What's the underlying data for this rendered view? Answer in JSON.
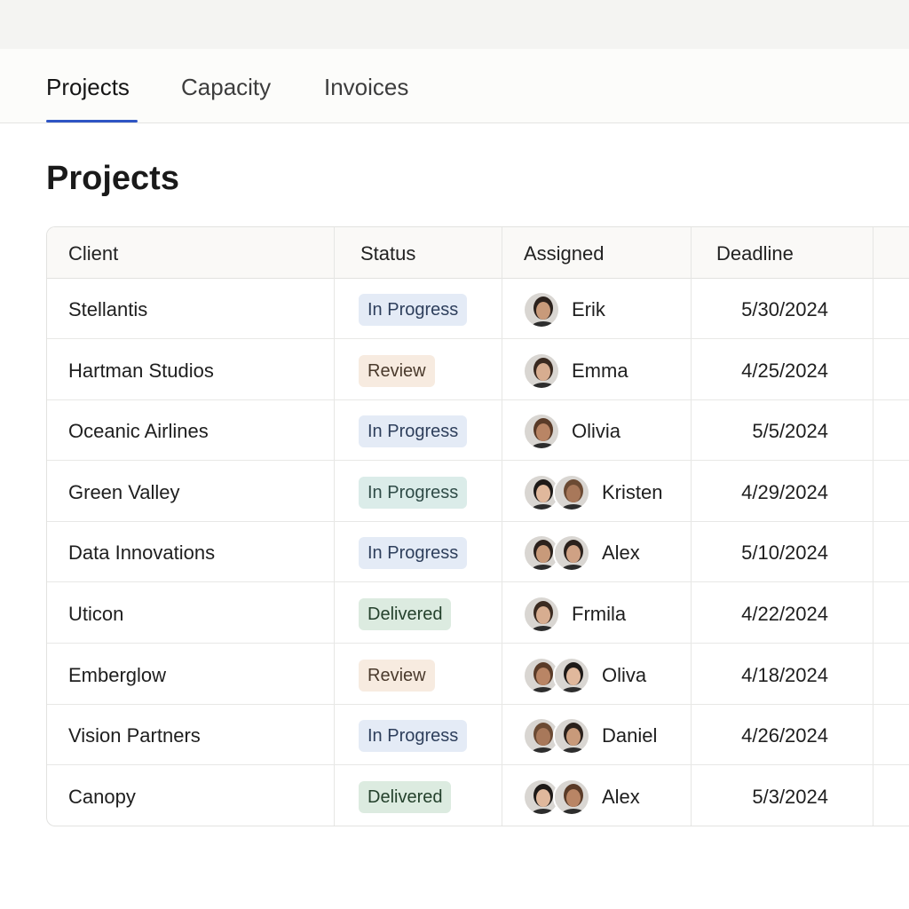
{
  "tabs": [
    {
      "label": "Projects",
      "active": true
    },
    {
      "label": "Capacity",
      "active": false
    },
    {
      "label": "Invoices",
      "active": false
    }
  ],
  "page_title": "Projects",
  "columns": {
    "client": "Client",
    "status": "Status",
    "assigned": "Assigned",
    "deadline": "Deadline"
  },
  "colors": {
    "accent": "#2f55c4",
    "badge_in_progress": "#e4ebf6",
    "badge_in_progress_teal": "#dbece9",
    "badge_review": "#f7ebe0",
    "badge_delivered": "#dcebe0"
  },
  "rows": [
    {
      "client": "Stellantis",
      "status": "In Progress",
      "assignee": "Erik",
      "deadline": "5/30/2024"
    },
    {
      "client": "Hartman Studios",
      "status": "Review",
      "assignee": "Emma",
      "deadline": "4/25/2024"
    },
    {
      "client": "Oceanic Airlines",
      "status": "In Progress",
      "assignee": "Olivia",
      "deadline": "5/5/2024"
    },
    {
      "client": "Green Valley",
      "status": "In Progress",
      "assignee": "Kristen",
      "deadline": "4/29/2024"
    },
    {
      "client": "Data Innovations",
      "status": "In Progress",
      "assignee": "Alex",
      "deadline": "5/10/2024"
    },
    {
      "client": "Uticon",
      "status": "Delivered",
      "assignee": "Frmila",
      "deadline": "4/22/2024"
    },
    {
      "client": "Emberglow",
      "status": "Review",
      "assignee": "Oliva",
      "deadline": "4/18/2024"
    },
    {
      "client": "Vision Partners",
      "status": "In Progress",
      "assignee": "Daniel",
      "deadline": "4/26/2024"
    },
    {
      "client": "Canopy",
      "status": "Delivered",
      "assignee": "Alex",
      "deadline": "5/3/2024"
    }
  ]
}
